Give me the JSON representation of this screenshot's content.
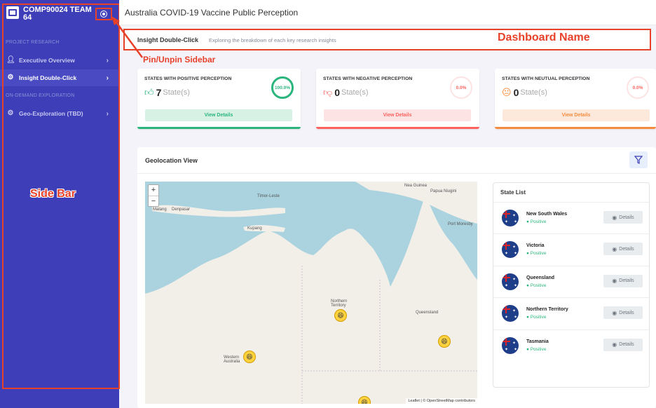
{
  "sidebar": {
    "brand": "COMP90024 TEAM 64",
    "section_research": "PROJECT RESEARCH",
    "section_exploration": "ON-DEMAND EXPLORATION",
    "items": [
      {
        "label": "Executive Overview",
        "icon": "user-icon"
      },
      {
        "label": "Insight Double-Click",
        "icon": "chip-icon",
        "active": true
      },
      {
        "label": "Geo-Exploration (TBD)",
        "icon": "gear-icon"
      }
    ]
  },
  "annotations": {
    "sidebar": "Side Bar",
    "pin": "Pin/Unpin Sidebar",
    "dashboard": "Dashboard Name"
  },
  "header": {
    "title": "Australia COVID-19 Vaccine Public Perception"
  },
  "breadcrumb": {
    "title": "Insight Double-Click",
    "subtitle": "Exploring the breakdown of each key research insights"
  },
  "cards": [
    {
      "title": "STATES WITH POSITIVE PERCEPTION",
      "count": "7",
      "unit": "State(s)",
      "percent": "100.0%",
      "button": "View Details",
      "color": "#2ab57d",
      "icon": "thumbs-up-icon"
    },
    {
      "title": "STATES WITH NEGATIVE PERCEPTION",
      "count": "0",
      "unit": "State(s)",
      "percent": "0.0%",
      "button": "View Details",
      "color": "#fd625e",
      "icon": "thumbs-down-icon"
    },
    {
      "title": "STATES WITH NEUTUAL PERCEPTION",
      "count": "0",
      "unit": "State(s)",
      "percent": "0.0%",
      "button": "View Details",
      "color": "#f58b3c",
      "icon": "neutral-face-icon"
    }
  ],
  "geo": {
    "title": "Geolocation View",
    "map_labels": {
      "nt": "Northern Territory",
      "wa": "Western Australia",
      "qld": "Queensland",
      "timor": "Timor-Leste",
      "kupang": "Kupang",
      "malang": "Malang",
      "denpasar": "Denpasar",
      "papua": "Papua Niugini",
      "port_moresby": "Port Moresby",
      "new_guinea": "Nea Guinea"
    },
    "zoom_in": "+",
    "zoom_out": "−",
    "attribution": "Leaflet | © OpenStreetMap contributors",
    "state_list_title": "State List",
    "states": [
      {
        "name": "New South Wales",
        "status": "Positive"
      },
      {
        "name": "Victoria",
        "status": "Positive"
      },
      {
        "name": "Queensland",
        "status": "Positive"
      },
      {
        "name": "Northern Territory",
        "status": "Positive"
      },
      {
        "name": "Tasmania",
        "status": "Positive"
      }
    ],
    "details_label": "Details"
  }
}
